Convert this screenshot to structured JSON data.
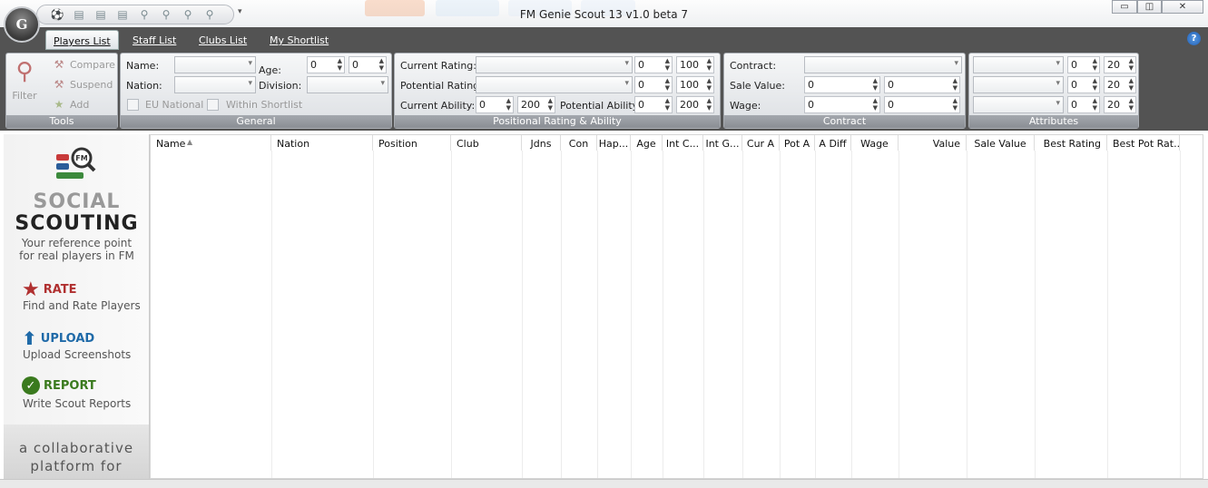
{
  "app": {
    "title": "FM Genie Scout 13 v1.0 beta 7",
    "logo_text": "G"
  },
  "quick_access": {
    "icons": [
      "scout-icon",
      "import-icon",
      "export-icon",
      "save-icon",
      "search-player-icon",
      "search-staff-icon",
      "find-icon",
      "compare-icon"
    ]
  },
  "tabs": [
    {
      "label": "Players List",
      "active": true
    },
    {
      "label": "Staff List"
    },
    {
      "label": "Clubs List"
    },
    {
      "label": "My Shortlist"
    }
  ],
  "ribbon": {
    "tools": {
      "caption": "Tools",
      "filter": "Filter",
      "compare": "Compare",
      "suspend": "Suspend",
      "add": "Add"
    },
    "general": {
      "caption": "General",
      "name": "Name:",
      "nation": "Nation:",
      "age": "Age:",
      "division": "Division:",
      "age_min": "0",
      "age_max": "0",
      "eu_national": "EU National",
      "within_shortlist": "Within Shortlist"
    },
    "positional": {
      "caption": "Positional Rating & Ability",
      "current_rating": "Current Rating:",
      "potential_rating": "Potential Rating:",
      "current_ability": "Current Ability:",
      "potential_ability": "Potential Ability:",
      "cr_min": "0",
      "cr_max": "100",
      "pr_min": "0",
      "pr_max": "100",
      "ca_min": "0",
      "ca_max": "200",
      "pa_min": "0",
      "pa_max": "200"
    },
    "contract": {
      "caption": "Contract",
      "contract": "Contract:",
      "sale_value": "Sale Value:",
      "wage": "Wage:",
      "sv_min": "0",
      "sv_max": "0",
      "wage_min": "0",
      "wage_max": "0"
    },
    "attributes": {
      "caption": "Attributes",
      "rows": [
        {
          "min": "0",
          "max": "20"
        },
        {
          "min": "0",
          "max": "20"
        },
        {
          "min": "0",
          "max": "20"
        }
      ]
    }
  },
  "sidebar": {
    "title1": "SOCIAL",
    "title2": "SCOUTING",
    "subtitle": "Your reference point for real players in FM",
    "rate": {
      "label": "RATE",
      "sub": "Find and Rate Players",
      "color": "#b03030"
    },
    "upload": {
      "label": "UPLOAD",
      "sub": "Upload Screenshots",
      "color": "#1f6aa8"
    },
    "report": {
      "label": "REPORT",
      "sub": "Write Scout Reports",
      "color": "#3a7a1e"
    },
    "footer": "a collaborative platform for"
  },
  "grid": {
    "columns": [
      "Name",
      "Nation",
      "Position",
      "Club",
      "Jdns",
      "Con",
      "Hap...",
      "Age",
      "Int C...",
      "Int G...",
      "Cur A",
      "Pot A",
      "A Diff",
      "Wage",
      "Value",
      "Sale Value",
      "Best Rating",
      "Best Pot Rat..."
    ]
  }
}
